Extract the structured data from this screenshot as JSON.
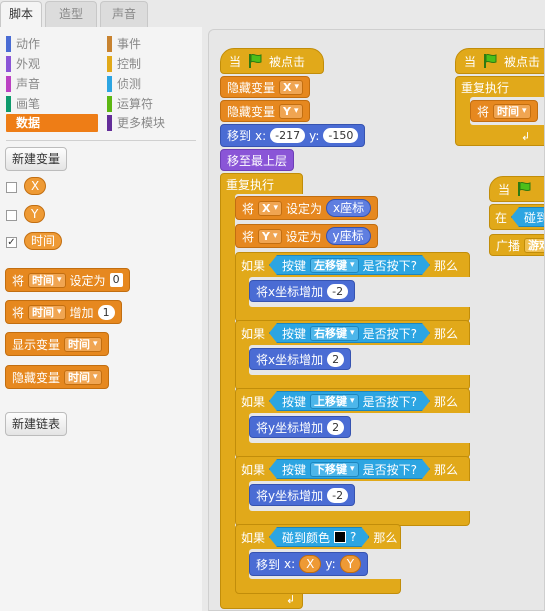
{
  "tabs": [
    {
      "label": "脚本",
      "active": true
    },
    {
      "label": "造型",
      "active": false
    },
    {
      "label": "声音",
      "active": false
    }
  ],
  "categories": [
    {
      "label": "动作",
      "color": "#4a6cd4"
    },
    {
      "label": "事件",
      "color": "#c88330"
    },
    {
      "label": "外观",
      "color": "#8a55d7"
    },
    {
      "label": "控制",
      "color": "#e1a91a"
    },
    {
      "label": "声音",
      "color": "#bb42c3"
    },
    {
      "label": "侦测",
      "color": "#2ca5e2"
    },
    {
      "label": "画笔",
      "color": "#0e9a6c"
    },
    {
      "label": "运算符",
      "color": "#5cb712"
    },
    {
      "label": "数据",
      "color": "#ee7d16",
      "selected": true
    },
    {
      "label": "更多模块",
      "color": "#632d99"
    }
  ],
  "palette": {
    "new_variable": "新建变量",
    "variables": [
      {
        "name": "X",
        "checked": false
      },
      {
        "name": "Y",
        "checked": false
      },
      {
        "name": "时间",
        "checked": true
      }
    ],
    "set_block": {
      "prefix": "将",
      "var": "时间",
      "action": "设定为",
      "value": "0"
    },
    "change_block": {
      "prefix": "将",
      "var": "时间",
      "action": "增加",
      "value": "1"
    },
    "show_block": {
      "label": "显示变量",
      "var": "时间"
    },
    "hide_block": {
      "label": "隐藏变量",
      "var": "时间"
    },
    "new_list": "新建链表"
  },
  "script": {
    "hat": {
      "when": "当",
      "clicked": "被点击"
    },
    "hide_x": {
      "label": "隐藏变量",
      "var": "X"
    },
    "hide_y": {
      "label": "隐藏变量",
      "var": "Y"
    },
    "goto": {
      "label": "移到",
      "x_label": "x:",
      "x": "-217",
      "y_label": "y:",
      "y": "-150"
    },
    "front": "移至最上层",
    "forever": "重复执行",
    "set_x": {
      "prefix": "将",
      "var": "X",
      "action": "设定为",
      "reporter": "x座标"
    },
    "set_y": {
      "prefix": "将",
      "var": "Y",
      "action": "设定为",
      "reporter": "y座标"
    },
    "if_left": {
      "if": "如果",
      "key_label": "按键",
      "key": "左移键",
      "pressed": "是否按下?",
      "then": "那么",
      "action": "将x坐标增加",
      "value": "-2"
    },
    "if_right": {
      "if": "如果",
      "key_label": "按键",
      "key": "右移键",
      "pressed": "是否按下?",
      "then": "那么",
      "action": "将x坐标增加",
      "value": "2"
    },
    "if_up": {
      "if": "如果",
      "key_label": "按键",
      "key": "上移键",
      "pressed": "是否按下?",
      "then": "那么",
      "action": "将y坐标增加",
      "value": "2"
    },
    "if_down": {
      "if": "如果",
      "key_label": "按键",
      "key": "下移键",
      "pressed": "是否按下?",
      "then": "那么",
      "action": "将y坐标增加",
      "value": "-2"
    },
    "if_color": {
      "if": "如果",
      "touch": "碰到颜色",
      "q": "?",
      "then": "那么",
      "goto": "移到",
      "x_label": "x:",
      "x": "X",
      "y_label": "y:",
      "y": "Y"
    }
  },
  "script2": {
    "when": "当",
    "clicked": "被点击",
    "forever": "重复执行",
    "set": "将",
    "var": "时间"
  },
  "script3": {
    "when": "当",
    "in": "在",
    "touch": "碰到",
    "broadcast": "广播",
    "msg": "游戏"
  }
}
